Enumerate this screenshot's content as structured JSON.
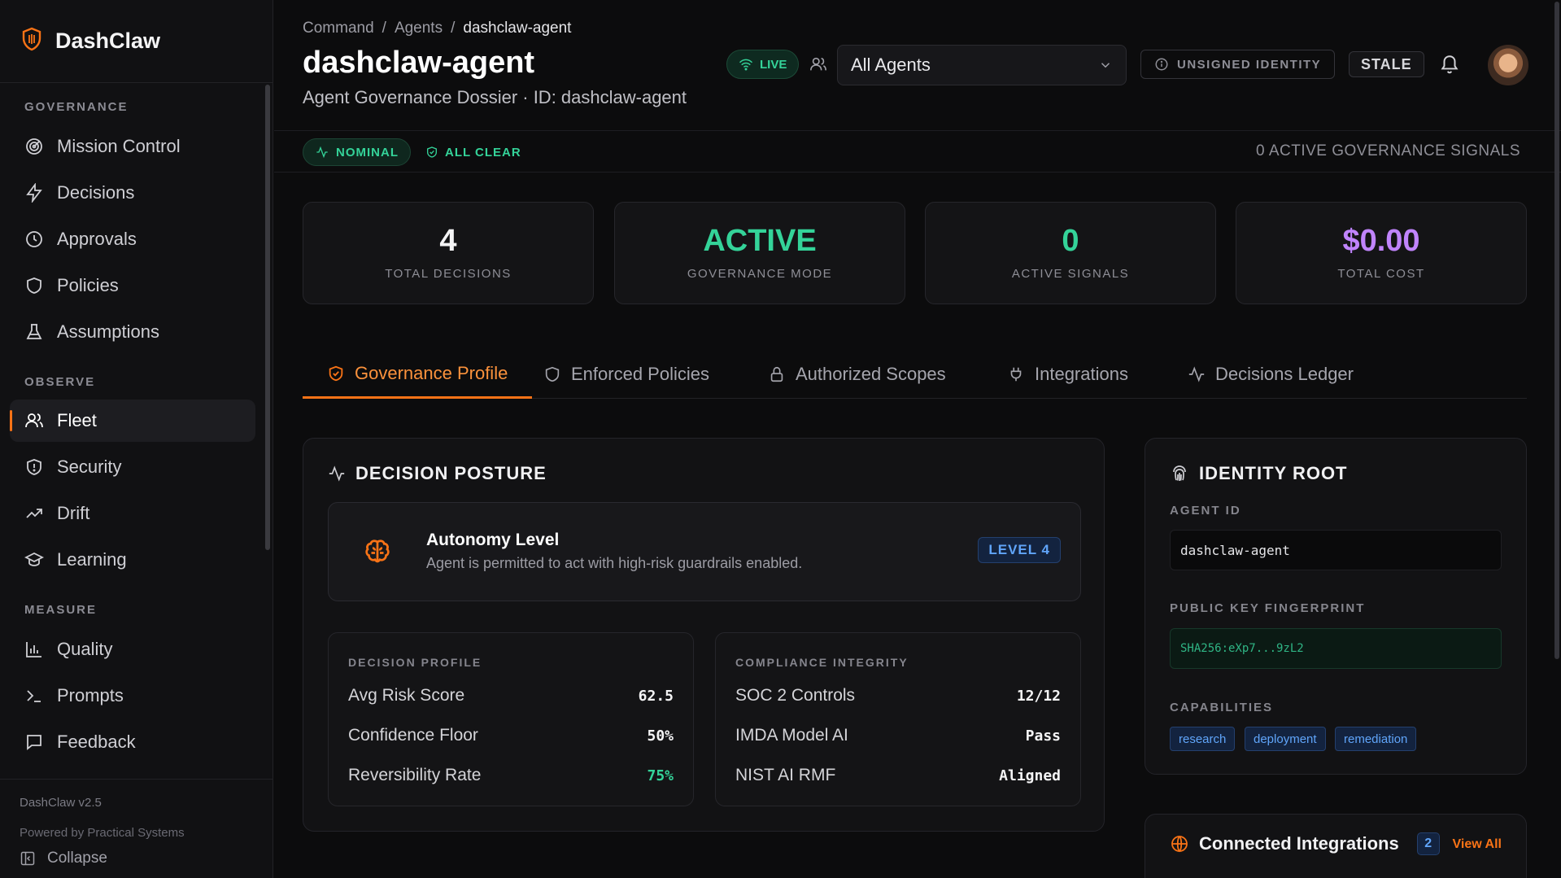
{
  "brand": {
    "name": "DashClaw"
  },
  "sidebar": {
    "sections": [
      {
        "label": "GOVERNANCE",
        "items": [
          "Mission Control",
          "Decisions",
          "Approvals",
          "Policies",
          "Assumptions"
        ]
      },
      {
        "label": "OBSERVE",
        "items": [
          "Fleet",
          "Security",
          "Drift",
          "Learning"
        ]
      },
      {
        "label": "MEASURE",
        "items": [
          "Quality",
          "Prompts",
          "Feedback"
        ]
      }
    ],
    "active": "Fleet",
    "version": "DashClaw v2.5",
    "powered_by": "Powered by Practical Systems",
    "collapse_label": "Collapse"
  },
  "header": {
    "breadcrumb": [
      "Command",
      "Agents",
      "dashclaw-agent"
    ],
    "title": "dashclaw-agent",
    "subtitle": "Agent Governance Dossier · ID: dashclaw-agent",
    "live_label": "LIVE",
    "agent_select": "All Agents",
    "identity_label": "UNSIGNED IDENTITY",
    "stale_label": "STALE"
  },
  "status": {
    "nominal": "NOMINAL",
    "all_clear": "ALL CLEAR",
    "signals_text": "0 ACTIVE GOVERNANCE SIGNALS"
  },
  "stats": [
    {
      "value": "4",
      "label": "TOTAL DECISIONS",
      "color": "#f4f4f5"
    },
    {
      "value": "ACTIVE",
      "label": "GOVERNANCE MODE",
      "color": "#34d399"
    },
    {
      "value": "0",
      "label": "ACTIVE SIGNALS",
      "color": "#34d399"
    },
    {
      "value": "$0.00",
      "label": "TOTAL COST",
      "color": "#c084fc"
    }
  ],
  "tabs": [
    "Governance Profile",
    "Enforced Policies",
    "Authorized Scopes",
    "Integrations",
    "Decisions Ledger"
  ],
  "posture": {
    "title": "DECISION POSTURE",
    "autonomy_title": "Autonomy Level",
    "autonomy_desc": "Agent is permitted to act with high-risk guardrails enabled.",
    "level": "LEVEL 4",
    "decision_profile": {
      "header": "DECISION PROFILE",
      "rows": [
        {
          "label": "Avg Risk Score",
          "value": "62.5"
        },
        {
          "label": "Confidence Floor",
          "value": "50%"
        },
        {
          "label": "Reversibility Rate",
          "value": "75%"
        }
      ]
    },
    "compliance": {
      "header": "COMPLIANCE INTEGRITY",
      "rows": [
        {
          "label": "SOC 2 Controls",
          "value": "12/12"
        },
        {
          "label": "IMDA Model AI",
          "value": "Pass"
        },
        {
          "label": "NIST AI RMF",
          "value": "Aligned"
        }
      ]
    }
  },
  "identity": {
    "title": "IDENTITY ROOT",
    "agent_id_label": "AGENT ID",
    "agent_id": "dashclaw-agent",
    "fingerprint_label": "PUBLIC KEY FINGERPRINT",
    "fingerprint": "SHA256:eXp7...9zL2",
    "capabilities_label": "CAPABILITIES",
    "capabilities": [
      "research",
      "deployment",
      "remediation"
    ]
  },
  "integrations": {
    "title": "Connected Integrations",
    "count": "2",
    "view_all": "View All"
  },
  "colors": {
    "accent": "#f97316",
    "success": "#34d399",
    "info": "#60a5fa",
    "cost": "#c084fc"
  }
}
